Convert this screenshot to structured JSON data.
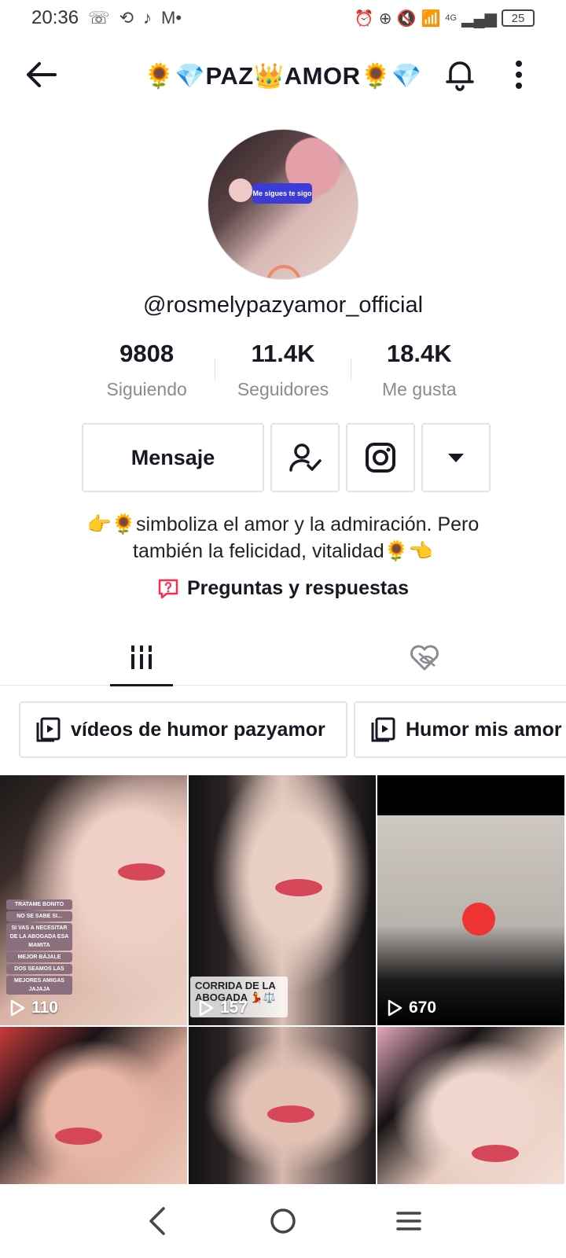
{
  "status_bar": {
    "time": "20:36",
    "network": "4G",
    "battery": "25"
  },
  "header": {
    "title": "🌻💎PAZ👑AMOR🌻💎"
  },
  "profile": {
    "username": "@rosmelypazyamor_official",
    "avatar_overlay_text": "Me sigues te sigo",
    "stats": [
      {
        "value": "9808",
        "label": "Siguiendo"
      },
      {
        "value": "11.4K",
        "label": "Seguidores"
      },
      {
        "value": "18.4K",
        "label": "Me gusta"
      }
    ],
    "message_button": "Mensaje",
    "bio_line1": "👉🌻simboliza  el amor y la admiración. Pero",
    "bio_line2": "también la felicidad, vitalidad🌻👈",
    "qa_label": "Preguntas y respuestas"
  },
  "playlists": [
    {
      "label": "vídeos de humor pazyamor"
    },
    {
      "label": "Humor mis amor"
    }
  ],
  "videos": [
    {
      "views": "110",
      "overlay": [
        "TRATAME BONITO",
        "NO SE SABE SI...",
        "SI VAS A NECESITAR DE LA ABOGADA ESA MAMITA",
        "MEJOR BÁJALE",
        "DOS SEAMOS LAS",
        "MEJORES AMIGAS JAJAJA"
      ]
    },
    {
      "views": "157",
      "caption": "CORRIDA DE LA ABOGADA 💃⚖️"
    },
    {
      "views": "670"
    },
    {},
    {},
    {}
  ],
  "colors": {
    "text": "#161823",
    "muted": "#8a8b91",
    "border": "#e3e3e4",
    "accent": "#fe2c55"
  }
}
